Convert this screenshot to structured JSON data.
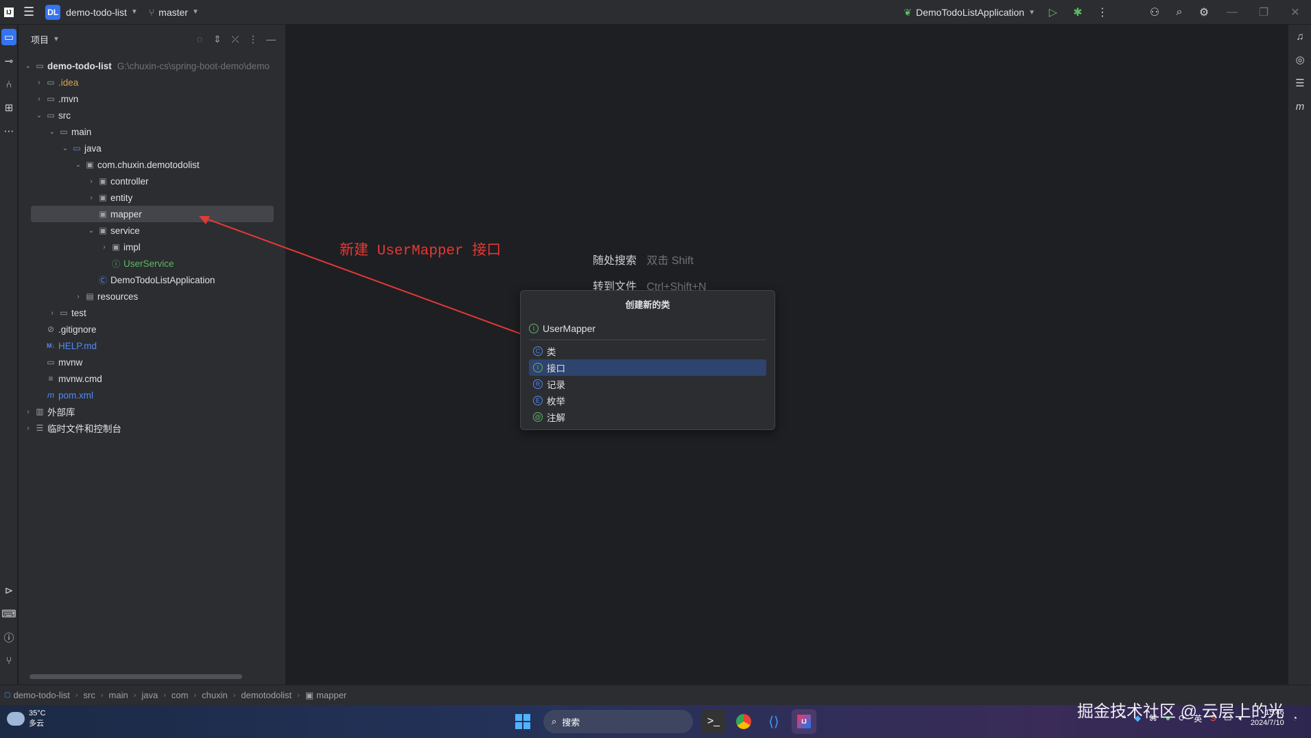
{
  "titlebar": {
    "project_badge": "DL",
    "project_name": "demo-todo-list",
    "branch": "master",
    "run_config": "DemoTodoListApplication"
  },
  "panel": {
    "title": "项目"
  },
  "tree": {
    "root": {
      "label": "demo-todo-list",
      "path": "G:\\chuxin-cs\\spring-boot-demo\\demo"
    },
    "idea": ".idea",
    "mvn": ".mvn",
    "src": "src",
    "main": "main",
    "java": "java",
    "package": "com.chuxin.demotodolist",
    "controller": "controller",
    "entity": "entity",
    "mapper": "mapper",
    "service": "service",
    "impl": "impl",
    "user_service": "UserService",
    "app_class": "DemoTodoListApplication",
    "resources": "resources",
    "test": "test",
    "gitignore": ".gitignore",
    "help": "HELP.md",
    "mvnw": "mvnw",
    "mvnw_cmd": "mvnw.cmd",
    "pom": "pom.xml",
    "external_libs": "外部库",
    "scratches": "临时文件和控制台"
  },
  "editor": {
    "hint_search": "随处搜索",
    "hint_search_key": "双击 Shift",
    "hint_goto": "转到文件",
    "hint_goto_key": "Ctrl+Shift+N",
    "annotation": "新建 UserMapper 接口"
  },
  "popup": {
    "title": "创建新的类",
    "input_value": "UserMapper",
    "items": [
      {
        "label": "类",
        "icon": "class-icon"
      },
      {
        "label": "接口",
        "icon": "interface-icon",
        "selected": true
      },
      {
        "label": "记录",
        "icon": "record-icon"
      },
      {
        "label": "枚举",
        "icon": "enum-icon"
      },
      {
        "label": "注解",
        "icon": "annotation-icon"
      }
    ]
  },
  "breadcrumb": [
    "demo-todo-list",
    "src",
    "main",
    "java",
    "com",
    "chuxin",
    "demotodolist",
    "mapper"
  ],
  "taskbar": {
    "temp": "35°C",
    "weather": "多云",
    "search_placeholder": "搜索",
    "ime": "英",
    "time": "15:46",
    "date": "2024/7/10"
  },
  "watermark": "掘金技术社区 @ 云层上的光",
  "colors": {
    "accent": "#3574f0",
    "selection": "#2e436e",
    "annotation": "#e53935",
    "bg": "#1e1f22",
    "panel": "#2b2d30"
  }
}
